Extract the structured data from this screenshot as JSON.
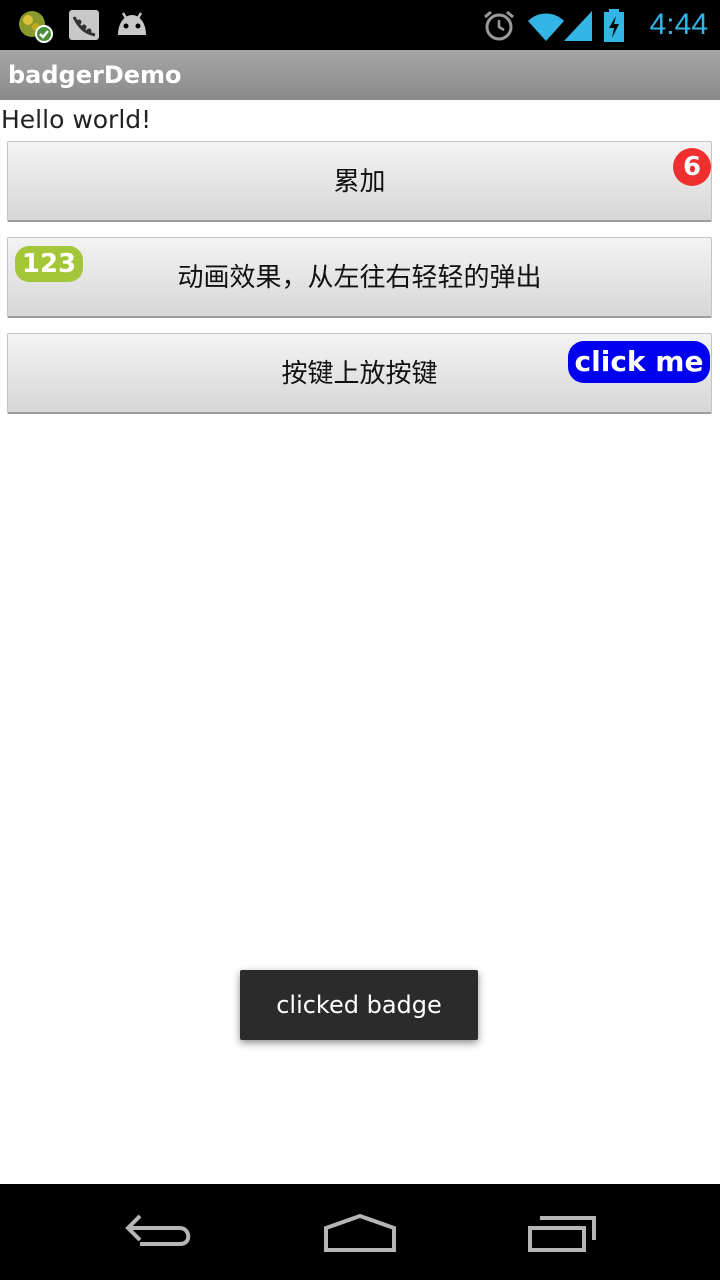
{
  "status_bar": {
    "time": "4:44",
    "icons": [
      "app-notification-icon",
      "beanstalk-notification-icon",
      "android-debug-icon",
      "alarm-icon",
      "wifi-icon",
      "signal-icon",
      "battery-charging-icon"
    ],
    "accent_color": "#33b5e5"
  },
  "action_bar": {
    "title": "badgerDemo"
  },
  "content": {
    "hello_text": "Hello world!",
    "buttons": [
      {
        "label": "累加",
        "badge": "6",
        "badge_color": "#ef2e2e"
      },
      {
        "label": "动画效果，从左往右轻轻的弹出",
        "badge": "123",
        "badge_color": "#a4c639"
      },
      {
        "label": "按键上放按键",
        "badge": "click me",
        "badge_color": "#0000f0"
      }
    ]
  },
  "toast": {
    "text": "clicked badge"
  },
  "nav_bar": {
    "icons": [
      "back-icon",
      "home-icon",
      "recent-apps-icon"
    ]
  }
}
